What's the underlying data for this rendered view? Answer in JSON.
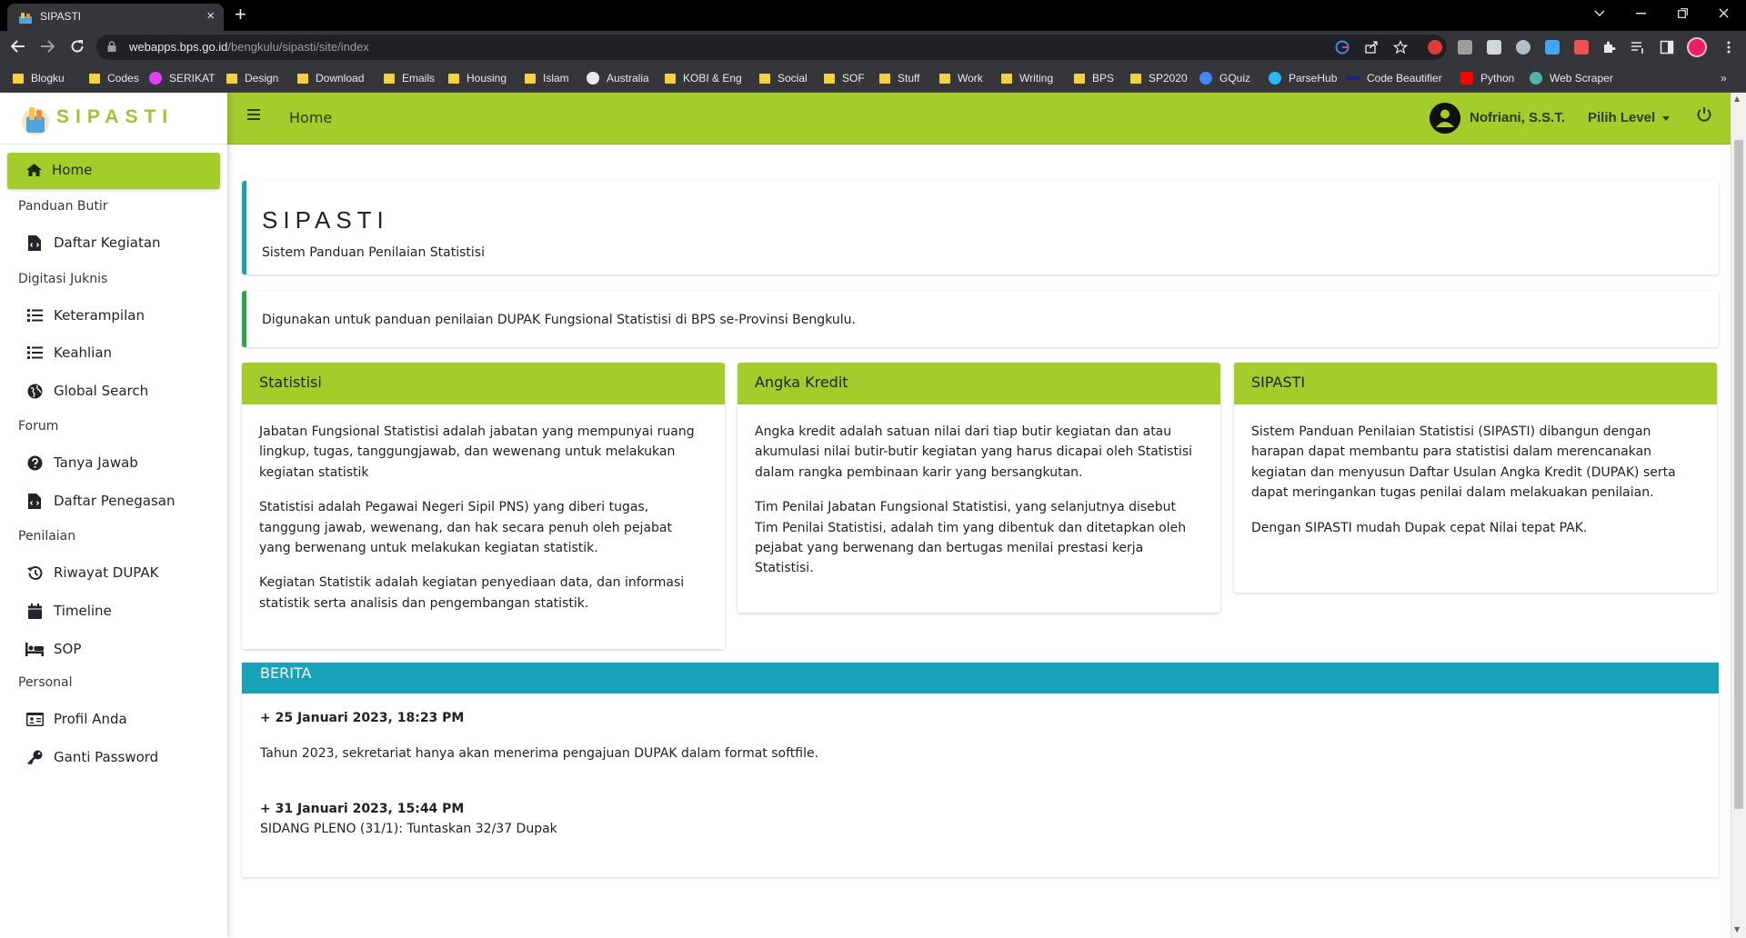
{
  "browser": {
    "tab_title": "SIPASTI",
    "tab_close": "×",
    "new_tab": "+",
    "url_host": "webapps.bps.go.id",
    "url_path": "/bengkulu/sipasti/site/index",
    "bookmarks": [
      {
        "label": "Blogku",
        "icon": "folder-icon"
      },
      {
        "label": "Codes",
        "icon": "folder-icon"
      },
      {
        "label": "SERIKAT",
        "icon": "serikat-icon"
      },
      {
        "label": "Design",
        "icon": "folder-icon"
      },
      {
        "label": "Download",
        "icon": "folder-icon"
      },
      {
        "label": "Emails",
        "icon": "folder-icon"
      },
      {
        "label": "Housing",
        "icon": "folder-icon"
      },
      {
        "label": "Islam",
        "icon": "folder-icon"
      },
      {
        "label": "Australia",
        "icon": "australia-icon"
      },
      {
        "label": "KOBI & Eng",
        "icon": "folder-icon"
      },
      {
        "label": "Social",
        "icon": "folder-icon"
      },
      {
        "label": "SOF",
        "icon": "folder-icon"
      },
      {
        "label": "Stuff",
        "icon": "folder-icon"
      },
      {
        "label": "Work",
        "icon": "folder-icon"
      },
      {
        "label": "Writing",
        "icon": "folder-icon"
      },
      {
        "label": "BPS",
        "icon": "folder-icon"
      },
      {
        "label": "SP2020",
        "icon": "folder-icon"
      },
      {
        "label": "GQuiz",
        "icon": "google-icon"
      },
      {
        "label": "ParseHub",
        "icon": "parsehub-icon"
      },
      {
        "label": "Code Beautifier",
        "icon": "codebeautifier-icon"
      },
      {
        "label": "Python",
        "icon": "youtube-icon"
      },
      {
        "label": "Web Scraper",
        "icon": "webscraper-icon"
      }
    ],
    "bookmarks_overflow": "»"
  },
  "app": {
    "brand": "SIPASTI",
    "topnav": {
      "title": "Home",
      "user_name": "Nofriani, S.S.T.",
      "level_label": "Pilih Level"
    },
    "sidebar": {
      "home": "Home",
      "sections": [
        {
          "header": "Panduan Butir",
          "items": [
            {
              "label": "Daftar Kegiatan",
              "icon": "file-code-icon"
            }
          ]
        },
        {
          "header": "Digitasi Juknis",
          "items": [
            {
              "label": "Keterampilan",
              "icon": "list-icon"
            },
            {
              "label": "Keahlian",
              "icon": "list-icon"
            },
            {
              "label": "Global Search",
              "icon": "globe-icon"
            }
          ]
        },
        {
          "header": "Forum",
          "items": [
            {
              "label": "Tanya Jawab",
              "icon": "question-circle-icon"
            },
            {
              "label": "Daftar Penegasan",
              "icon": "file-code-icon"
            }
          ]
        },
        {
          "header": "Penilaian",
          "items": [
            {
              "label": "Riwayat DUPAK",
              "icon": "history-icon"
            },
            {
              "label": "Timeline",
              "icon": "calendar-icon"
            },
            {
              "label": "SOP",
              "icon": "bed-icon"
            }
          ]
        },
        {
          "header": "Personal",
          "items": [
            {
              "label": "Profil Anda",
              "icon": "id-card-icon"
            },
            {
              "label": "Ganti Password",
              "icon": "key-icon"
            }
          ]
        }
      ]
    },
    "hero": {
      "title": "SIPASTI",
      "subtitle": "Sistem Panduan Penilaian Statistisi"
    },
    "intro": "Digunakan untuk panduan penilaian DUPAK Fungsional Statistisi di BPS se-Provinsi Bengkulu.",
    "cards": [
      {
        "title": "Statistisi",
        "paragraphs": [
          "Jabatan Fungsional Statistisi adalah jabatan yang mempunyai ruang lingkup, tugas, tanggungjawab, dan wewenang untuk melakukan kegiatan statistik",
          "Statistisi adalah Pegawai Negeri Sipil PNS) yang diberi tugas, tanggung jawab, wewenang, dan hak secara penuh oleh pejabat yang berwenang untuk melakukan kegiatan statistik.",
          "Kegiatan Statistik adalah kegiatan penyediaan data, dan informasi statistik serta analisis dan pengembangan statistik."
        ]
      },
      {
        "title": "Angka Kredit",
        "paragraphs": [
          "Angka kredit adalah satuan nilai dari tiap butir kegiatan dan atau akumulasi nilai butir-butir kegiatan yang harus dicapai oleh Statistisi dalam rangka pembinaan karir yang bersangkutan.",
          "Tim Penilai Jabatan Fungsional Statistisi, yang selanjutnya disebut Tim Penilai Statistisi, adalah tim yang dibentuk dan ditetapkan oleh pejabat yang berwenang dan bertugas menilai prestasi kerja Statistisi."
        ]
      },
      {
        "title": "SIPASTI",
        "paragraphs": [
          "Sistem Panduan Penilaian Statistisi (SIPASTI) dibangun dengan harapan dapat membantu para statistisi dalam merencanakan kegiatan dan menyusun Daftar Usulan Angka Kredit (DUPAK) serta dapat meringankan tugas penilai dalam melakuakan penilaian.",
          "Dengan SIPASTI mudah Dupak cepat Nilai tepat PAK."
        ]
      }
    ],
    "news": {
      "header": "BERITA",
      "items": [
        {
          "date": "+ 25 Januari 2023, 18:23 PM",
          "text": "Tahun 2023, sekretariat hanya akan menerima pengajuan DUPAK dalam format softfile."
        },
        {
          "date": "+ 31 Januari 2023, 15:44 PM",
          "text": "SIDANG PLENO (31/1): Tuntaskan 32/37 Dupak"
        }
      ]
    },
    "colors": {
      "primary_green": "#a4cc2b",
      "info_teal": "#17a2b8",
      "success_green": "#28a745"
    }
  }
}
